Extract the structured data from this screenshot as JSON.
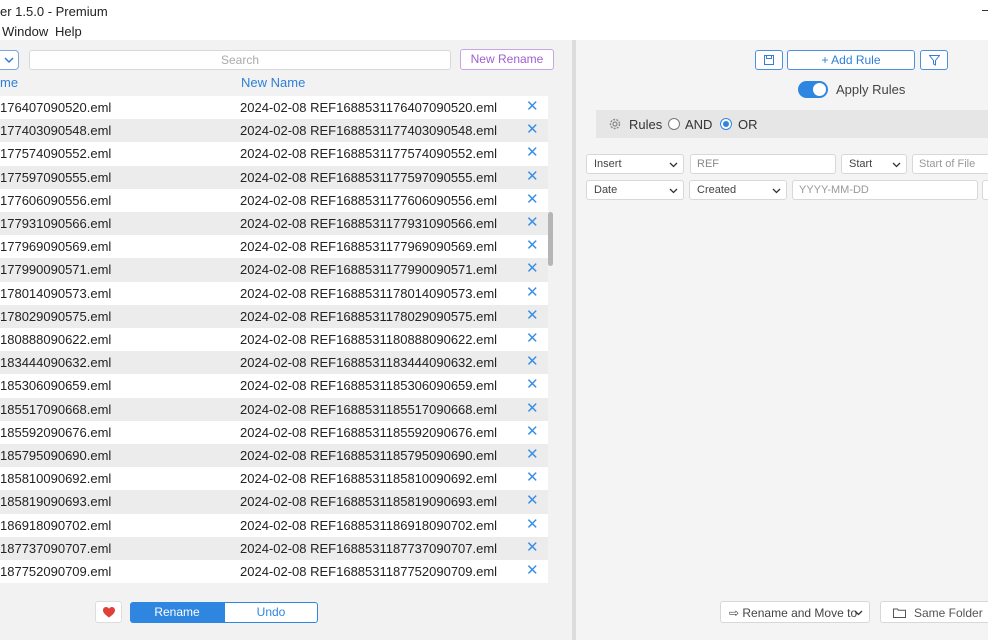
{
  "window": {
    "title": "er 1.5.0 - Premium"
  },
  "menu": [
    "Window",
    "Help"
  ],
  "toolbar": {
    "search_placeholder": "Search",
    "new_rename_label": "New Rename"
  },
  "columns": {
    "original": "me",
    "new": "New Name"
  },
  "rows": [
    {
      "original": "176407090520.eml",
      "new": "2024-02-08 REF1688531176407090520.eml"
    },
    {
      "original": "177403090548.eml",
      "new": "2024-02-08 REF1688531177403090548.eml"
    },
    {
      "original": "177574090552.eml",
      "new": "2024-02-08 REF1688531177574090552.eml"
    },
    {
      "original": "177597090555.eml",
      "new": "2024-02-08 REF1688531177597090555.eml"
    },
    {
      "original": "177606090556.eml",
      "new": "2024-02-08 REF1688531177606090556.eml"
    },
    {
      "original": "177931090566.eml",
      "new": "2024-02-08 REF1688531177931090566.eml"
    },
    {
      "original": "177969090569.eml",
      "new": "2024-02-08 REF1688531177969090569.eml"
    },
    {
      "original": "177990090571.eml",
      "new": "2024-02-08 REF1688531177990090571.eml"
    },
    {
      "original": "178014090573.eml",
      "new": "2024-02-08 REF1688531178014090573.eml"
    },
    {
      "original": "178029090575.eml",
      "new": "2024-02-08 REF1688531178029090575.eml"
    },
    {
      "original": "180888090622.eml",
      "new": "2024-02-08 REF1688531180888090622.eml"
    },
    {
      "original": "183444090632.eml",
      "new": "2024-02-08 REF1688531183444090632.eml"
    },
    {
      "original": "185306090659.eml",
      "new": "2024-02-08 REF1688531185306090659.eml"
    },
    {
      "original": "185517090668.eml",
      "new": "2024-02-08 REF1688531185517090668.eml"
    },
    {
      "original": "185592090676.eml",
      "new": "2024-02-08 REF1688531185592090676.eml"
    },
    {
      "original": "185795090690.eml",
      "new": "2024-02-08 REF1688531185795090690.eml"
    },
    {
      "original": "185810090692.eml",
      "new": "2024-02-08 REF1688531185810090692.eml"
    },
    {
      "original": "185819090693.eml",
      "new": "2024-02-08 REF1688531185819090693.eml"
    },
    {
      "original": "186918090702.eml",
      "new": "2024-02-08 REF1688531186918090702.eml"
    },
    {
      "original": "187737090707.eml",
      "new": "2024-02-08 REF1688531187737090707.eml"
    },
    {
      "original": "187752090709.eml",
      "new": "2024-02-08 REF1688531187752090709.eml"
    }
  ],
  "row_delete_glyph": "✕",
  "actions": {
    "rename_label": "Rename",
    "undo_label": "Undo"
  },
  "rules_panel": {
    "add_rule_label": "+ Add Rule",
    "apply_rules_label": "Apply Rules",
    "apply_rules_on": true,
    "rules_label": "Rules",
    "and_label": "AND",
    "or_label": "OR",
    "logic": "OR",
    "rule1": {
      "action": "Insert",
      "text": "REF",
      "position": "Start",
      "position_placeholder": "Start of File"
    },
    "rule2": {
      "action": "Date",
      "date_type": "Created",
      "format_placeholder": "YYYY-MM-DD"
    }
  },
  "footer": {
    "move_label": "⇨ Rename and Move to",
    "same_folder_label": "Same Folder"
  },
  "colors": {
    "accent": "#2f86e0",
    "new_rename": "#a060d0",
    "heart": "#e0403a"
  },
  "icons": [
    "chevron-down-icon",
    "save-icon",
    "filter-icon",
    "gear-icon",
    "heart-icon",
    "folder-icon",
    "close-icon"
  ]
}
